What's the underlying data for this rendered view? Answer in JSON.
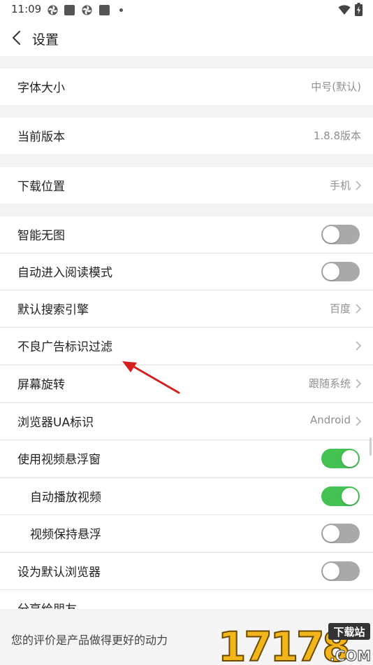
{
  "status_bar": {
    "time": "11:09"
  },
  "header": {
    "title": "设置"
  },
  "settings": [
    {
      "label": "字体大小",
      "value": "中号(默认)"
    },
    {
      "label": "当前版本",
      "value": "1.8.8版本"
    },
    {
      "label": "下载位置",
      "value": "手机"
    },
    {
      "label": "智能无图",
      "toggle": false
    },
    {
      "label": "自动进入阅读模式",
      "toggle": false
    },
    {
      "label": "默认搜索引擎",
      "value": "百度"
    },
    {
      "label": "不良广告标识过滤"
    },
    {
      "label": "屏幕旋转",
      "value": "跟随系统"
    },
    {
      "label": "浏览器UA标识",
      "value": "Android"
    },
    {
      "label": "使用视频悬浮窗",
      "toggle": true
    },
    {
      "label": "自动播放视频",
      "toggle": true
    },
    {
      "label": "视频保持悬浮",
      "toggle": false
    },
    {
      "label": "设为默认浏览器",
      "toggle": false
    },
    {
      "label": "分享给朋友"
    }
  ],
  "footer": {
    "rate_text": "您的评价是产品做得更好的动力"
  },
  "watermark": {
    "number": "17178",
    "tag": "下载站",
    "domain": ".COM"
  },
  "colors": {
    "toggle_on": "#43c152",
    "toggle_off": "#a9a9a9",
    "annotation_arrow": "#d42020"
  }
}
